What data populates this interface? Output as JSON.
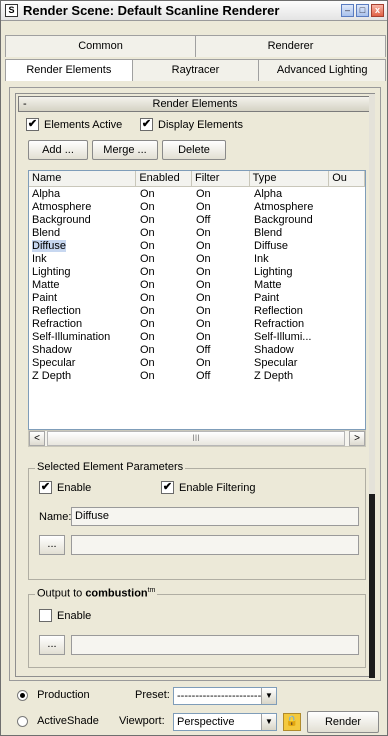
{
  "window": {
    "title": "Render Scene: Default Scanline Renderer",
    "app_icon": "S",
    "minimize": "–",
    "maximize": "□",
    "close": "x"
  },
  "tabs": {
    "row1": [
      "Common",
      "Renderer"
    ],
    "row2": [
      "Render Elements",
      "Raytracer",
      "Advanced Lighting"
    ],
    "active": "Render Elements"
  },
  "rollout": {
    "title": "Render Elements",
    "collapse": "-",
    "elements_active": "Elements Active",
    "display_elements": "Display Elements",
    "buttons": {
      "add": "Add ...",
      "merge": "Merge ...",
      "delete": "Delete"
    }
  },
  "table": {
    "columns": [
      "Name",
      "Enabled",
      "Filter",
      "Type",
      "Ou"
    ],
    "rows": [
      [
        "Alpha",
        "On",
        "On",
        "Alpha"
      ],
      [
        "Atmosphere",
        "On",
        "On",
        "Atmosphere"
      ],
      [
        "Background",
        "On",
        "Off",
        "Background"
      ],
      [
        "Blend",
        "On",
        "On",
        "Blend"
      ],
      [
        "Diffuse",
        "On",
        "On",
        "Diffuse"
      ],
      [
        "Ink",
        "On",
        "On",
        "Ink"
      ],
      [
        "Lighting",
        "On",
        "On",
        "Lighting"
      ],
      [
        "Matte",
        "On",
        "On",
        "Matte"
      ],
      [
        "Paint",
        "On",
        "On",
        "Paint"
      ],
      [
        "Reflection",
        "On",
        "On",
        "Reflection"
      ],
      [
        "Refraction",
        "On",
        "On",
        "Refraction"
      ],
      [
        "Self-Illumination",
        "On",
        "On",
        "Self-Illumi..."
      ],
      [
        "Shadow",
        "On",
        "Off",
        "Shadow"
      ],
      [
        "Specular",
        "On",
        "On",
        "Specular"
      ],
      [
        "Z Depth",
        "On",
        "Off",
        "Z Depth"
      ]
    ],
    "selected_row": "Diffuse",
    "scroll_left": "<",
    "scroll_right": ">",
    "scroll_grip": "III"
  },
  "selected_params": {
    "legend": "Selected Element Parameters",
    "enable": "Enable",
    "enable_filtering": "Enable Filtering",
    "name_label": "Name:",
    "name_value": "Diffuse",
    "browse": "..."
  },
  "combustion": {
    "legend_prefix": "Output to ",
    "legend_bold": "combustion",
    "tm": "tm",
    "enable": "Enable",
    "browse": "..."
  },
  "bottom": {
    "production": "Production",
    "activeshade": "ActiveShade",
    "preset_label": "Preset:",
    "preset_value": "------------------------",
    "viewport_label": "Viewport:",
    "viewport_value": "Perspective",
    "render": "Render",
    "lock_icon": "🔒",
    "dropdown_arrow": "▼"
  }
}
